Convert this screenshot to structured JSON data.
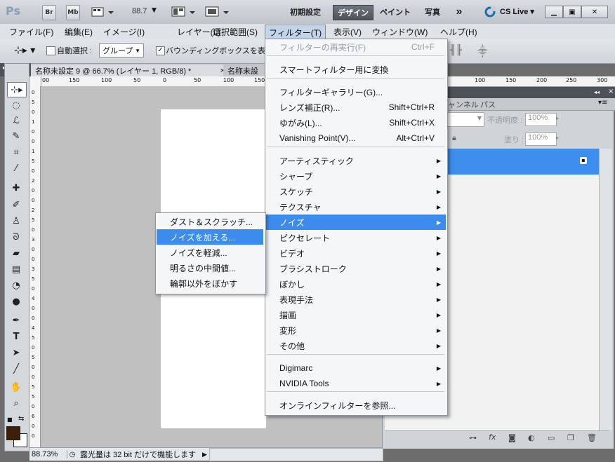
{
  "app": {
    "logo": "Ps",
    "bridge_label": "Br",
    "minibridge_label": "Mb",
    "zoom_value": "88.7",
    "workspaces": [
      "初期設定",
      "デザイン",
      "ペイント",
      "写真"
    ],
    "active_workspace": "デザイン",
    "more_label": "»",
    "cslive": "CS Live"
  },
  "menubar": [
    "ファイル(F)",
    "編集(E)",
    "イメージ(I)",
    "レイヤー(L)",
    "選択範囲(S)",
    "フィルター(T)",
    "表示(V)",
    "ウィンドウ(W)",
    "ヘルプ(H)"
  ],
  "options": {
    "auto_select_label": "自動選択 :",
    "auto_select_value": "グループ",
    "bbox_label": "バウンディングボックスを表示"
  },
  "tabs": [
    {
      "label": "名称未設定 9 @ 66.7% (レイヤー 1, RGB/8) *",
      "close": "×"
    },
    {
      "label": "名称未設"
    }
  ],
  "ruler": {
    "h_ticks": [
      "00",
      "150",
      "100",
      "50",
      "0",
      "50",
      "100",
      "150"
    ],
    "v_ticks": [
      "0",
      "5",
      "0",
      "1",
      "0",
      "0",
      "1",
      "5",
      "0",
      "2",
      "0",
      "0",
      "2",
      "5",
      "0",
      "3",
      "0",
      "0",
      "3",
      "5",
      "0",
      "4",
      "0",
      "0",
      "4",
      "5",
      "0",
      "5",
      "0",
      "0",
      "5",
      "5",
      "0",
      "6",
      "0",
      "0"
    ],
    "right_ticks": [
      "100",
      "150",
      "200",
      "250",
      "300",
      "35"
    ]
  },
  "status": {
    "zoom": "88.73%",
    "info": "露光量は 32 bit だけで機能します"
  },
  "panel": {
    "tabs": [
      "ャンネル",
      "パス"
    ],
    "opacity_label": "不透明度 :",
    "opacity_value": "100%",
    "fill_label": "塗り :",
    "fill_value": "100%"
  },
  "filter_menu": {
    "items": [
      {
        "label": "フィルターの再実行(F)",
        "shortcut": "Ctrl+F",
        "disabled": true
      },
      {
        "label": "スマートフィルター用に変換"
      },
      {
        "label": "フィルターギャラリー(G)..."
      },
      {
        "label": "レンズ補正(R)...",
        "shortcut": "Shift+Ctrl+R"
      },
      {
        "label": "ゆがみ(L)...",
        "shortcut": "Shift+Ctrl+X"
      },
      {
        "label": "Vanishing Point(V)...",
        "shortcut": "Alt+Ctrl+V"
      },
      {
        "label": "アーティスティック",
        "submenu": true
      },
      {
        "label": "シャープ",
        "submenu": true
      },
      {
        "label": "スケッチ",
        "submenu": true
      },
      {
        "label": "テクスチャ",
        "submenu": true
      },
      {
        "label": "ノイズ",
        "submenu": true,
        "highlighted": true
      },
      {
        "label": "ピクセレート",
        "submenu": true
      },
      {
        "label": "ビデオ",
        "submenu": true
      },
      {
        "label": "ブラシストローク",
        "submenu": true
      },
      {
        "label": "ぼかし",
        "submenu": true
      },
      {
        "label": "表現手法",
        "submenu": true
      },
      {
        "label": "描画",
        "submenu": true
      },
      {
        "label": "変形",
        "submenu": true
      },
      {
        "label": "その他",
        "submenu": true
      },
      {
        "label": "Digimarc",
        "submenu": true
      },
      {
        "label": "NVIDIA Tools",
        "submenu": true
      },
      {
        "label": "オンラインフィルターを参照..."
      }
    ]
  },
  "noise_menu": {
    "items": [
      {
        "label": "ダスト＆スクラッチ..."
      },
      {
        "label": "ノイズを加える...",
        "highlighted": true
      },
      {
        "label": "ノイズを軽減..."
      },
      {
        "label": "明るさの中間値..."
      },
      {
        "label": "輪郭以外をぼかす"
      }
    ]
  },
  "colors": {
    "highlight": "#3b8ced",
    "foreground_swatch": "#3c1f05",
    "layer_selected": "#3e8eed"
  }
}
